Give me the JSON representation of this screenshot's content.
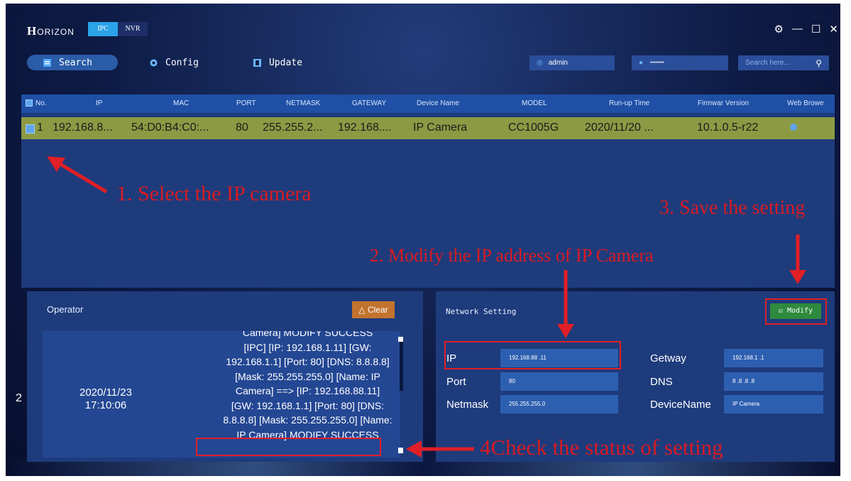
{
  "app": {
    "logo_initial": "H",
    "logo_text": "ORIZON",
    "mode_tabs": [
      "IPC",
      "NVR"
    ],
    "window_controls": [
      "⚙",
      "—",
      "☐",
      "✕"
    ]
  },
  "toolbar": {
    "search_label": "Search",
    "config_label": "Config",
    "update_label": "Update",
    "username_value": "admin",
    "password_value": "••••••••",
    "search_placeholder": "Search here..."
  },
  "table": {
    "headers": [
      "No.",
      "IP",
      "MAC",
      "PORT",
      "NETMASK",
      "GATEWAY",
      "Device Name",
      "MODEL",
      "Run-up Time",
      "Firmwar Version",
      "Web Browe"
    ],
    "rows": [
      {
        "no": "1",
        "ip": "192.168.8...",
        "mac": "54:D0:B4:C0:...",
        "port": "80",
        "netmask": "255.255.2...",
        "gateway": "192.168....",
        "device_name": "IP Camera",
        "model": "CC1005G",
        "run_up_time": "2020/11/20 ...",
        "firmware": "10.1.0.5-r22"
      }
    ]
  },
  "operator": {
    "title": "Operator",
    "clear_label": "Clear",
    "log_index": "2",
    "log_date": "2020/11/23",
    "log_time": "17:10:06",
    "log_lines": [
      "Camera] MODIFY SUCCESS",
      "[IPC] [IP: 192.168.1.11] [GW:",
      "192.168.1.1] [Port: 80] [DNS: 8.8.8.8]",
      "[Mask: 255.255.255.0] [Name: IP",
      "Camera] ==> [IP: 192.168.88.11]",
      "[GW: 192.168.1.1] [Port: 80] [DNS:",
      "8.8.8.8] [Mask: 255.255.255.0] [Name:",
      "IP Camera] MODIFY SUCCESS"
    ]
  },
  "network": {
    "title": "Network Setting",
    "modify_label": "Modify",
    "ip_label": "IP",
    "ip_value": "192.168.88 .11",
    "port_label": "Port",
    "port_value": "80",
    "netmask_label": "Netmask",
    "netmask_value": "255.255.255.0",
    "getway_label": "Getway",
    "getway_value": "192.168.1 .1",
    "dns_label": "DNS",
    "dns_value": "8 .8 .8 .8",
    "devicename_label": "DeviceName",
    "devicename_value": "IP Camera"
  },
  "annotations": {
    "step1": "1. Select the IP camera",
    "step2": "2. Modify the IP address of IP Camera",
    "step3": "3. Save the setting",
    "step4": "4Check the status of setting"
  },
  "colors": {
    "background": "#0d1b45",
    "accent_blue": "#2aa3e8",
    "selected_row": "#8c9a44",
    "annotation_red": "#d91b22",
    "clear_button": "#c2732e",
    "modify_button": "#2e8a3e"
  }
}
